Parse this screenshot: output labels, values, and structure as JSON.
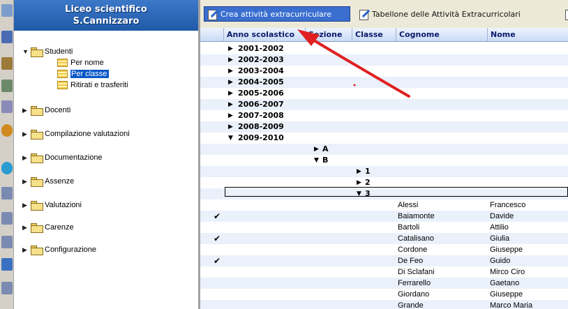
{
  "header": {
    "line1": "Liceo scientifico",
    "line2": "S.Cannizzaro"
  },
  "tree": {
    "studenti": "Studenti",
    "per_nome": "Per nome",
    "per_classe": "Per classe",
    "ritirati": "Ritirati e trasferiti",
    "docenti": "Docenti",
    "compilazione": "Compilazione valutazioni",
    "documentazione": "Documentazione",
    "assenze": "Assenze",
    "valutazioni": "Valutazioni",
    "carenze": "Carenze",
    "configurazione": "Configurazione"
  },
  "toolbar": {
    "crea": "Crea attività extracurriculare",
    "tabellone": "Tabellone delle Attività Extracurricolari"
  },
  "columns": [
    "Anno scolastico",
    "Sezione",
    "Classe",
    "Cognome",
    "Nome"
  ],
  "years": [
    "2001-2002",
    "2002-2003",
    "2003-2004",
    "2004-2005",
    "2005-2006",
    "2006-2007",
    "2007-2008",
    "2008-2009",
    "2009-2010"
  ],
  "sections": [
    "A",
    "B"
  ],
  "classes": [
    "1",
    "2",
    "3"
  ],
  "students": [
    {
      "cognome": "Alessi",
      "nome": "Francesco",
      "checked": false
    },
    {
      "cognome": "Baiamonte",
      "nome": "Davide",
      "checked": true
    },
    {
      "cognome": "Bartoli",
      "nome": "Attilio",
      "checked": false
    },
    {
      "cognome": "Catalisano",
      "nome": "Giulia",
      "checked": true
    },
    {
      "cognome": "Cordone",
      "nome": "Giuseppe",
      "checked": false
    },
    {
      "cognome": "De Feo",
      "nome": "Guido",
      "checked": true
    },
    {
      "cognome": "Di Sclafani",
      "nome": "Mirco Ciro",
      "checked": false
    },
    {
      "cognome": "Ferrarello",
      "nome": "Gaetano",
      "checked": false
    },
    {
      "cognome": "Giordano",
      "nome": "Giuseppe",
      "checked": false
    },
    {
      "cognome": "Grande",
      "nome": "Marco Maria",
      "checked": false
    }
  ],
  "colors": {
    "header_blue": "#1f5aa8",
    "selection": "#0a58c8",
    "annotation_arrow": "#e02020"
  },
  "icons": [
    "folder-icon",
    "list-icon",
    "pencil-icon",
    "check-icon"
  ]
}
